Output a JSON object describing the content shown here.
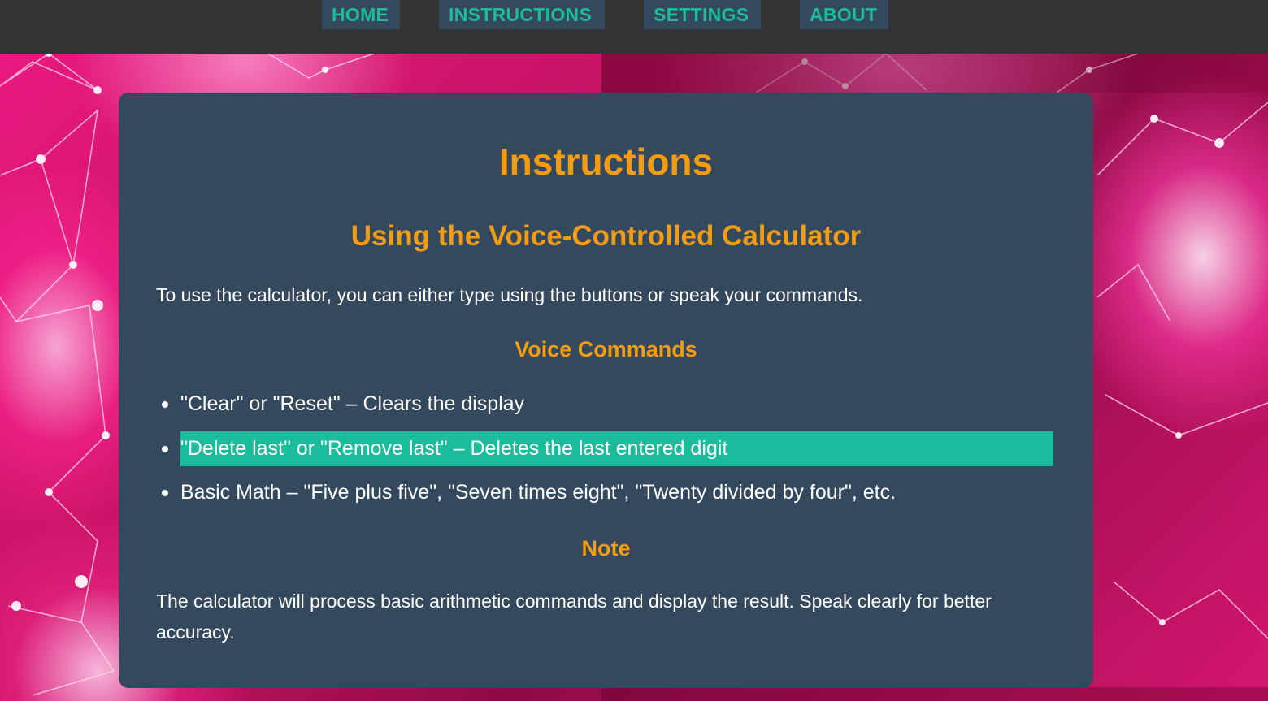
{
  "nav": {
    "items": [
      {
        "label": "HOME"
      },
      {
        "label": "INSTRUCTIONS"
      },
      {
        "label": "SETTINGS"
      },
      {
        "label": "ABOUT"
      }
    ]
  },
  "colors": {
    "nav_bg": "#333333",
    "nav_link_bg": "#34495e",
    "nav_link_text": "#1abc9c",
    "card_bg": "#34495e",
    "heading": "#f39c12",
    "highlight": "#1abc9c",
    "text": "#ffffff",
    "background_accent": "#e8197f"
  },
  "main": {
    "title": "Instructions",
    "subtitle": "Using the Voice-Controlled Calculator",
    "intro": "To use the calculator, you can either type using the buttons or speak your commands.",
    "voice_heading": "Voice Commands",
    "commands": [
      {
        "text": "\"Clear\" or \"Reset\" – Clears the display",
        "highlighted": false
      },
      {
        "text": "\"Delete last\" or \"Remove last\" – Deletes the last entered digit",
        "highlighted": true
      },
      {
        "text": "Basic Math – \"Five plus five\", \"Seven times eight\", \"Twenty divided by four\", etc.",
        "highlighted": false
      }
    ],
    "note_heading": "Note",
    "note_text": "The calculator will process basic arithmetic commands and display the result. Speak clearly for better accuracy."
  }
}
